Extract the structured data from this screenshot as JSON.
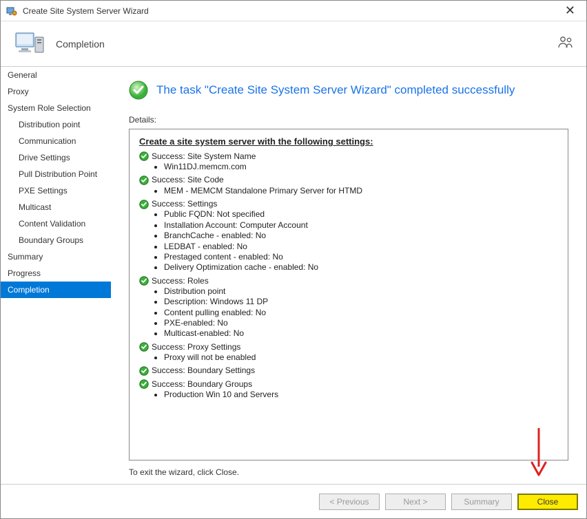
{
  "titlebar": {
    "title": "Create Site System Server Wizard"
  },
  "header": {
    "heading": "Completion"
  },
  "nav": {
    "items": [
      {
        "label": "General",
        "indent": false
      },
      {
        "label": "Proxy",
        "indent": false
      },
      {
        "label": "System Role Selection",
        "indent": false
      },
      {
        "label": "Distribution point",
        "indent": true
      },
      {
        "label": "Communication",
        "indent": true
      },
      {
        "label": "Drive Settings",
        "indent": true
      },
      {
        "label": "Pull Distribution Point",
        "indent": true
      },
      {
        "label": "PXE Settings",
        "indent": true
      },
      {
        "label": "Multicast",
        "indent": true
      },
      {
        "label": "Content Validation",
        "indent": true
      },
      {
        "label": "Boundary Groups",
        "indent": true
      },
      {
        "label": "Summary",
        "indent": false
      },
      {
        "label": "Progress",
        "indent": false
      },
      {
        "label": "Completion",
        "indent": false,
        "selected": true
      }
    ]
  },
  "completion": {
    "title": "The task \"Create Site System Server Wizard\" completed successfully",
    "detailsLabel": "Details:",
    "exitText": "To exit the wizard, click Close.",
    "heading": "Create a site system server with the following settings:",
    "groups": [
      {
        "title": "Success: Site System Name",
        "items": [
          "Win11DJ.memcm.com"
        ]
      },
      {
        "title": "Success: Site Code",
        "items": [
          "MEM - MEMCM Standalone Primary Server for HTMD"
        ]
      },
      {
        "title": "Success: Settings",
        "items": [
          "Public FQDN: Not specified",
          "Installation Account: Computer Account",
          "BranchCache - enabled:  No",
          "LEDBAT - enabled:  No",
          "Prestaged content - enabled:  No",
          "Delivery Optimization cache - enabled:  No"
        ]
      },
      {
        "title": "Success: Roles",
        "items": [
          "Distribution point",
          "Description: Windows 11 DP",
          "Content pulling enabled: No",
          "PXE-enabled: No",
          "Multicast-enabled: No"
        ]
      },
      {
        "title": "Success: Proxy Settings",
        "items": [
          "Proxy will not be enabled"
        ]
      },
      {
        "title": "Success: Boundary Settings",
        "items": []
      },
      {
        "title": "Success: Boundary Groups",
        "items": [
          "Production Win 10 and Servers"
        ]
      }
    ]
  },
  "buttons": {
    "previous": "< Previous",
    "next": "Next >",
    "summary": "Summary",
    "close": "Close"
  }
}
